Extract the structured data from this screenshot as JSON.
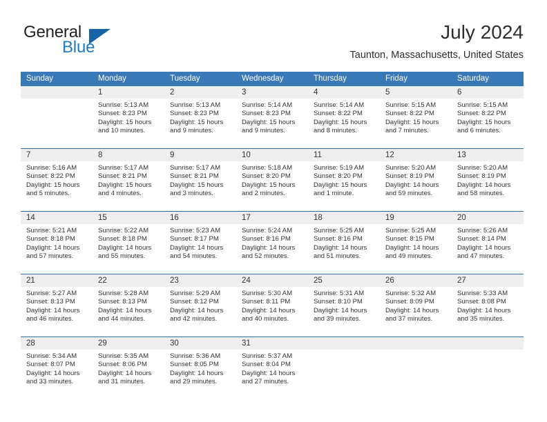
{
  "logo": {
    "word_one": "General",
    "word_two": "Blue",
    "triangle_color": "#1763a8",
    "blue_text_color": "#1f7cc0"
  },
  "header": {
    "month_title": "July 2024",
    "location": "Taunton, Massachusetts, United States"
  },
  "theme": {
    "header_blue": "#3a79b8",
    "separator_blue": "#2f6aa8",
    "daynum_gray": "#efefef",
    "text_color": "#333333"
  },
  "calendar": {
    "weekday_headers": [
      "Sunday",
      "Monday",
      "Tuesday",
      "Wednesday",
      "Thursday",
      "Friday",
      "Saturday"
    ],
    "weeks": [
      [
        {
          "day": "",
          "empty": true,
          "sunrise": "",
          "sunset": "",
          "daylight_line1": "",
          "daylight_line2": ""
        },
        {
          "day": "1",
          "empty": false,
          "sunrise": "Sunrise: 5:13 AM",
          "sunset": "Sunset: 8:23 PM",
          "daylight_line1": "Daylight: 15 hours",
          "daylight_line2": "and 10 minutes."
        },
        {
          "day": "2",
          "empty": false,
          "sunrise": "Sunrise: 5:13 AM",
          "sunset": "Sunset: 8:23 PM",
          "daylight_line1": "Daylight: 15 hours",
          "daylight_line2": "and 9 minutes."
        },
        {
          "day": "3",
          "empty": false,
          "sunrise": "Sunrise: 5:14 AM",
          "sunset": "Sunset: 8:23 PM",
          "daylight_line1": "Daylight: 15 hours",
          "daylight_line2": "and 9 minutes."
        },
        {
          "day": "4",
          "empty": false,
          "sunrise": "Sunrise: 5:14 AM",
          "sunset": "Sunset: 8:22 PM",
          "daylight_line1": "Daylight: 15 hours",
          "daylight_line2": "and 8 minutes."
        },
        {
          "day": "5",
          "empty": false,
          "sunrise": "Sunrise: 5:15 AM",
          "sunset": "Sunset: 8:22 PM",
          "daylight_line1": "Daylight: 15 hours",
          "daylight_line2": "and 7 minutes."
        },
        {
          "day": "6",
          "empty": false,
          "sunrise": "Sunrise: 5:15 AM",
          "sunset": "Sunset: 8:22 PM",
          "daylight_line1": "Daylight: 15 hours",
          "daylight_line2": "and 6 minutes."
        }
      ],
      [
        {
          "day": "7",
          "empty": false,
          "sunrise": "Sunrise: 5:16 AM",
          "sunset": "Sunset: 8:22 PM",
          "daylight_line1": "Daylight: 15 hours",
          "daylight_line2": "and 5 minutes."
        },
        {
          "day": "8",
          "empty": false,
          "sunrise": "Sunrise: 5:17 AM",
          "sunset": "Sunset: 8:21 PM",
          "daylight_line1": "Daylight: 15 hours",
          "daylight_line2": "and 4 minutes."
        },
        {
          "day": "9",
          "empty": false,
          "sunrise": "Sunrise: 5:17 AM",
          "sunset": "Sunset: 8:21 PM",
          "daylight_line1": "Daylight: 15 hours",
          "daylight_line2": "and 3 minutes."
        },
        {
          "day": "10",
          "empty": false,
          "sunrise": "Sunrise: 5:18 AM",
          "sunset": "Sunset: 8:20 PM",
          "daylight_line1": "Daylight: 15 hours",
          "daylight_line2": "and 2 minutes."
        },
        {
          "day": "11",
          "empty": false,
          "sunrise": "Sunrise: 5:19 AM",
          "sunset": "Sunset: 8:20 PM",
          "daylight_line1": "Daylight: 15 hours",
          "daylight_line2": "and 1 minute."
        },
        {
          "day": "12",
          "empty": false,
          "sunrise": "Sunrise: 5:20 AM",
          "sunset": "Sunset: 8:19 PM",
          "daylight_line1": "Daylight: 14 hours",
          "daylight_line2": "and 59 minutes."
        },
        {
          "day": "13",
          "empty": false,
          "sunrise": "Sunrise: 5:20 AM",
          "sunset": "Sunset: 8:19 PM",
          "daylight_line1": "Daylight: 14 hours",
          "daylight_line2": "and 58 minutes."
        }
      ],
      [
        {
          "day": "14",
          "empty": false,
          "sunrise": "Sunrise: 5:21 AM",
          "sunset": "Sunset: 8:18 PM",
          "daylight_line1": "Daylight: 14 hours",
          "daylight_line2": "and 57 minutes."
        },
        {
          "day": "15",
          "empty": false,
          "sunrise": "Sunrise: 5:22 AM",
          "sunset": "Sunset: 8:18 PM",
          "daylight_line1": "Daylight: 14 hours",
          "daylight_line2": "and 55 minutes."
        },
        {
          "day": "16",
          "empty": false,
          "sunrise": "Sunrise: 5:23 AM",
          "sunset": "Sunset: 8:17 PM",
          "daylight_line1": "Daylight: 14 hours",
          "daylight_line2": "and 54 minutes."
        },
        {
          "day": "17",
          "empty": false,
          "sunrise": "Sunrise: 5:24 AM",
          "sunset": "Sunset: 8:16 PM",
          "daylight_line1": "Daylight: 14 hours",
          "daylight_line2": "and 52 minutes."
        },
        {
          "day": "18",
          "empty": false,
          "sunrise": "Sunrise: 5:25 AM",
          "sunset": "Sunset: 8:16 PM",
          "daylight_line1": "Daylight: 14 hours",
          "daylight_line2": "and 51 minutes."
        },
        {
          "day": "19",
          "empty": false,
          "sunrise": "Sunrise: 5:25 AM",
          "sunset": "Sunset: 8:15 PM",
          "daylight_line1": "Daylight: 14 hours",
          "daylight_line2": "and 49 minutes."
        },
        {
          "day": "20",
          "empty": false,
          "sunrise": "Sunrise: 5:26 AM",
          "sunset": "Sunset: 8:14 PM",
          "daylight_line1": "Daylight: 14 hours",
          "daylight_line2": "and 47 minutes."
        }
      ],
      [
        {
          "day": "21",
          "empty": false,
          "sunrise": "Sunrise: 5:27 AM",
          "sunset": "Sunset: 8:13 PM",
          "daylight_line1": "Daylight: 14 hours",
          "daylight_line2": "and 46 minutes."
        },
        {
          "day": "22",
          "empty": false,
          "sunrise": "Sunrise: 5:28 AM",
          "sunset": "Sunset: 8:13 PM",
          "daylight_line1": "Daylight: 14 hours",
          "daylight_line2": "and 44 minutes."
        },
        {
          "day": "23",
          "empty": false,
          "sunrise": "Sunrise: 5:29 AM",
          "sunset": "Sunset: 8:12 PM",
          "daylight_line1": "Daylight: 14 hours",
          "daylight_line2": "and 42 minutes."
        },
        {
          "day": "24",
          "empty": false,
          "sunrise": "Sunrise: 5:30 AM",
          "sunset": "Sunset: 8:11 PM",
          "daylight_line1": "Daylight: 14 hours",
          "daylight_line2": "and 40 minutes."
        },
        {
          "day": "25",
          "empty": false,
          "sunrise": "Sunrise: 5:31 AM",
          "sunset": "Sunset: 8:10 PM",
          "daylight_line1": "Daylight: 14 hours",
          "daylight_line2": "and 39 minutes."
        },
        {
          "day": "26",
          "empty": false,
          "sunrise": "Sunrise: 5:32 AM",
          "sunset": "Sunset: 8:09 PM",
          "daylight_line1": "Daylight: 14 hours",
          "daylight_line2": "and 37 minutes."
        },
        {
          "day": "27",
          "empty": false,
          "sunrise": "Sunrise: 5:33 AM",
          "sunset": "Sunset: 8:08 PM",
          "daylight_line1": "Daylight: 14 hours",
          "daylight_line2": "and 35 minutes."
        }
      ],
      [
        {
          "day": "28",
          "empty": false,
          "sunrise": "Sunrise: 5:34 AM",
          "sunset": "Sunset: 8:07 PM",
          "daylight_line1": "Daylight: 14 hours",
          "daylight_line2": "and 33 minutes."
        },
        {
          "day": "29",
          "empty": false,
          "sunrise": "Sunrise: 5:35 AM",
          "sunset": "Sunset: 8:06 PM",
          "daylight_line1": "Daylight: 14 hours",
          "daylight_line2": "and 31 minutes."
        },
        {
          "day": "30",
          "empty": false,
          "sunrise": "Sunrise: 5:36 AM",
          "sunset": "Sunset: 8:05 PM",
          "daylight_line1": "Daylight: 14 hours",
          "daylight_line2": "and 29 minutes."
        },
        {
          "day": "31",
          "empty": false,
          "sunrise": "Sunrise: 5:37 AM",
          "sunset": "Sunset: 8:04 PM",
          "daylight_line1": "Daylight: 14 hours",
          "daylight_line2": "and 27 minutes."
        },
        {
          "day": "",
          "empty": true,
          "sunrise": "",
          "sunset": "",
          "daylight_line1": "",
          "daylight_line2": ""
        },
        {
          "day": "",
          "empty": true,
          "sunrise": "",
          "sunset": "",
          "daylight_line1": "",
          "daylight_line2": ""
        },
        {
          "day": "",
          "empty": true,
          "sunrise": "",
          "sunset": "",
          "daylight_line1": "",
          "daylight_line2": ""
        }
      ]
    ]
  }
}
